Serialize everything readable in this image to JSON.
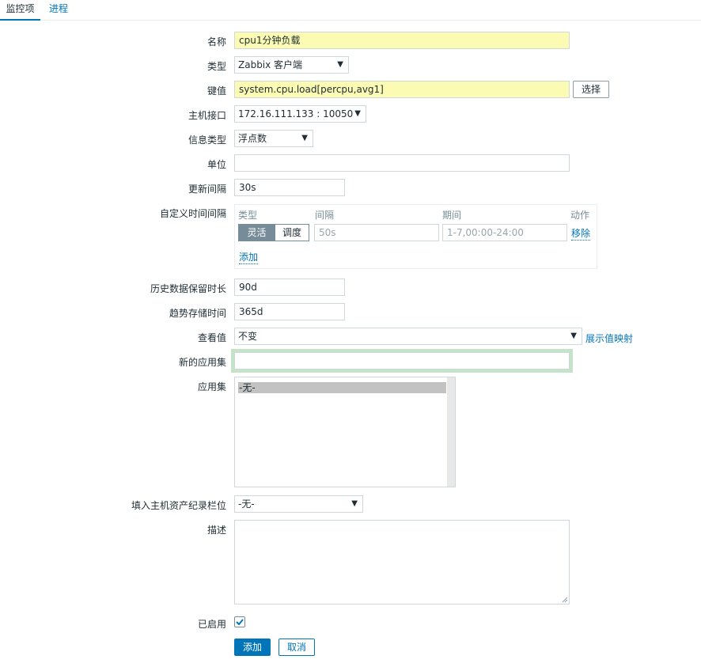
{
  "tabs": [
    {
      "label": "监控项",
      "active": true
    },
    {
      "label": "进程",
      "active": false
    }
  ],
  "form": {
    "name": {
      "label": "名称",
      "value": "cpu1分钟负载"
    },
    "type": {
      "label": "类型",
      "value": "Zabbix 客户端"
    },
    "key": {
      "label": "键值",
      "value": "system.cpu.load[percpu,avg1]",
      "button": "选择"
    },
    "interface": {
      "label": "主机接口",
      "value": "172.16.111.133 : 10050"
    },
    "info_type": {
      "label": "信息类型",
      "value": "浮点数"
    },
    "units": {
      "label": "单位",
      "value": ""
    },
    "update_interval": {
      "label": "更新间隔",
      "value": "30s"
    },
    "custom_intervals": {
      "label": "自定义时间间隔",
      "headers": {
        "type": "类型",
        "interval": "间隔",
        "period": "期间",
        "action": "动作"
      },
      "toggle": {
        "flexible": "灵活",
        "scheduling": "调度"
      },
      "interval_placeholder": "50s",
      "period_placeholder": "1-7,00:00-24:00",
      "remove": "移除",
      "add": "添加"
    },
    "history": {
      "label": "历史数据保留时长",
      "value": "90d"
    },
    "trends": {
      "label": "趋势存储时间",
      "value": "365d"
    },
    "valuemap": {
      "label": "查看值",
      "value": "不变",
      "link": "展示值映射"
    },
    "new_application": {
      "label": "新的应用集",
      "value": ""
    },
    "applications": {
      "label": "应用集",
      "items": [
        "-无-"
      ]
    },
    "inventory": {
      "label": "填入主机资产纪录栏位",
      "value": "-无-"
    },
    "description": {
      "label": "描述",
      "value": ""
    },
    "enabled": {
      "label": "已启用",
      "checked": true
    },
    "buttons": {
      "add": "添加",
      "cancel": "取消"
    }
  },
  "colors": {
    "accent": "#0275b8",
    "input_highlight": "#fbfbb4",
    "focus_border": "#c4e3c9"
  }
}
